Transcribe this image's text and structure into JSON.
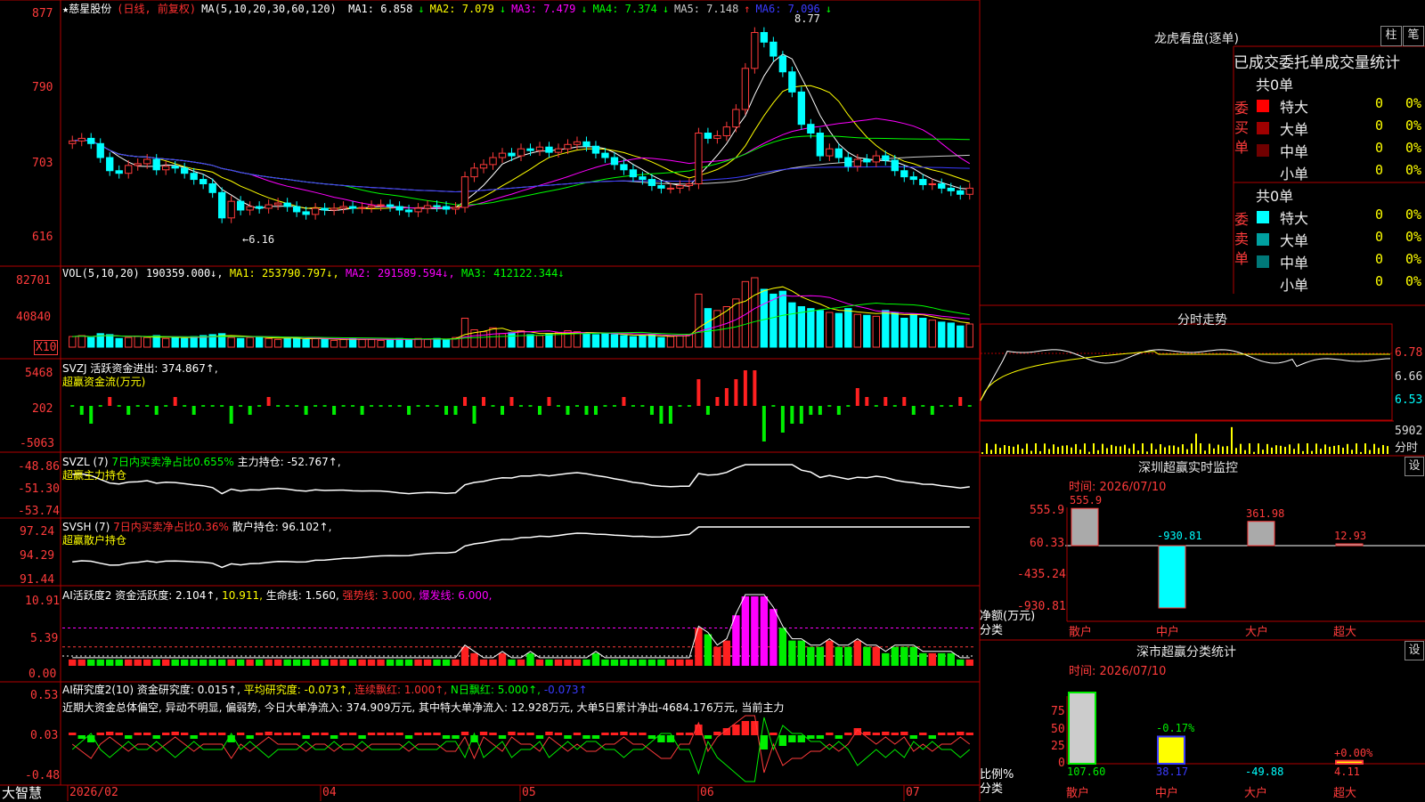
{
  "header": {
    "star": "★",
    "stock_name": "慈星股份",
    "period": "(日线, 前复权)",
    "ma_params": "MA(5,10,20,30,60,120)",
    "ma": [
      {
        "label": "MA1: 6.858",
        "arrow": "↓",
        "color": "#ffffff"
      },
      {
        "label": "MA2: 7.079",
        "arrow": "↓",
        "color": "#ffff00"
      },
      {
        "label": "MA3: 7.479",
        "arrow": "↓",
        "color": "#ff00ff"
      },
      {
        "label": "MA4: 7.374",
        "arrow": "↓",
        "color": "#00ff00"
      },
      {
        "label": "MA5: 7.148",
        "arrow": "↑",
        "color": "#cccccc"
      },
      {
        "label": "MA6: 7.096",
        "arrow": "↓",
        "color": "#3a3aff"
      }
    ]
  },
  "main_axis": {
    "top": "877",
    "t2": "790",
    "t3": "703",
    "t4": "616",
    "max_label": "8.77",
    "min_label": "←6.16"
  },
  "vol": {
    "header_title": "VOL(5,10,20)",
    "header_value": "190359.000↓,",
    "ma1": "MA1: 253790.797↓,",
    "ma2": "MA2: 291589.594↓,",
    "ma3": "MA3: 412122.344↓",
    "axis_top": "82701",
    "axis_mid": "40840",
    "axis_unit": "X10"
  },
  "svzj": {
    "title": "SVZJ  活跃资金进出: 374.867↑,",
    "sub": "超赢资金流(万元)",
    "axis_top": "5468",
    "axis_mid": "202",
    "axis_bot": "-5063"
  },
  "svzl": {
    "title_a": "SVZL (7)",
    "title_b": "7日内买卖净占比0.655%",
    "title_c": "主力持仓: -52.767↑,",
    "sub": "超赢主力持仓",
    "axis_top": "-48.86",
    "axis_mid": "-51.30",
    "axis_bot": "-53.74"
  },
  "svsh": {
    "title_a": "SVSH (7)",
    "title_b": "7日内买卖净占比0.36%",
    "title_c": "散户持仓: 96.102↑,",
    "sub": "超赢散户持仓",
    "axis_top": "97.24",
    "axis_mid": "94.29",
    "axis_bot": "91.44"
  },
  "ai_act": {
    "t1": "AI活跃度2 资金活跃度: 2.104↑,",
    "t2": "10.911,",
    "t3": "生命线: 1.560,",
    "t4": "强势线: 3.000,",
    "t5": "爆发线: 6.000,",
    "axis_top": "10.91",
    "axis_mid": "5.39",
    "axis_bot": "0.00"
  },
  "ai_res": {
    "t1": "AI研究度2(10) 资金研究度: 0.015↑,",
    "t2": "平均研究度: -0.073↑,",
    "t3": "连续飘红: 1.000↑,",
    "t4": "N日飘红: 5.000↑,",
    "t5": "-0.073↑",
    "summary": "近期大资金总体偏空, 异动不明显, 偏弱势, 今日大单净流入: 374.909万元, 其中特大单净流入: 12.928万元, 大单5日累计净出-4684.176万元, 当前主力",
    "axis_top": "0.53",
    "axis_mid": "0.03",
    "axis_bot": "-0.48"
  },
  "date_axis": {
    "brand": "大智慧",
    "labels": [
      "2026/02",
      "04",
      "05",
      "06",
      "07"
    ]
  },
  "right": {
    "lhb_title": "龙虎看盘(逐单)",
    "btn_zhu": "柱",
    "btn_bi": "笔",
    "stats_header": "已成交委托单成交量统计",
    "buy_label": "委买单",
    "sell_label": "委卖单",
    "buy_total": "共0单",
    "sell_total": "共0单",
    "buy_rows": [
      {
        "name": "特大",
        "count": "0",
        "pct": "0%",
        "color": "#ff0000"
      },
      {
        "name": "大单",
        "count": "0",
        "pct": "0%",
        "color": "#a00000"
      },
      {
        "name": "中单",
        "count": "0",
        "pct": "0%",
        "color": "#700000"
      },
      {
        "name": "小单",
        "count": "0",
        "pct": "0%",
        "color": ""
      }
    ],
    "sell_rows": [
      {
        "name": "特大",
        "count": "0",
        "pct": "0%",
        "color": "#00ffff"
      },
      {
        "name": "大单",
        "count": "0",
        "pct": "0%",
        "color": "#00a0a0"
      },
      {
        "name": "中单",
        "count": "0",
        "pct": "0%",
        "color": "#007878"
      },
      {
        "name": "小单",
        "count": "0",
        "pct": "0%",
        "color": ""
      }
    ],
    "fenshi_title": "分时走势",
    "fenshi_y": [
      "6.78",
      "6.66",
      "6.53"
    ],
    "fenshi_vol": "5902",
    "fenshi_unit": "分时",
    "sz_monitor_title": "深圳超赢实时监控",
    "sz_monitor_date": "时间: 2026/07/10",
    "sz_monitor_axis": [
      "555.9",
      "60.33",
      "-435.24",
      "-930.81"
    ],
    "sz_monitor_y_title": "净额(万元)",
    "sz_monitor_x_title": "分类",
    "sz_monitor_values": [
      {
        "name": "散户",
        "value": "555.9"
      },
      {
        "name": "中户",
        "value": "-930.81"
      },
      {
        "name": "大户",
        "value": "361.98"
      },
      {
        "name": "超大",
        "value": "12.93"
      }
    ],
    "sz_stat_title": "深市超赢分类统计",
    "sz_stat_date": "时间: 2026/07/10",
    "sz_stat_axis": [
      "75",
      "50",
      "25",
      "0"
    ],
    "sz_stat_y_title": "比例%",
    "sz_stat_x_title": "分类",
    "sz_stat_values": [
      {
        "name": "散户",
        "value": "107.60",
        "change": ""
      },
      {
        "name": "中户",
        "value": "38.17",
        "change": "-0.17%"
      },
      {
        "name": "大户",
        "value": "-49.88",
        "change": ""
      },
      {
        "name": "超大",
        "value": "4.11",
        "change": "+0.00%"
      }
    ],
    "set_btn": "设"
  },
  "chart_data": {
    "type": "candlestick",
    "price_range": [
      6.16,
      8.77
    ],
    "closes": [
      7.39,
      7.42,
      7.36,
      7.2,
      7.05,
      7.02,
      7.11,
      7.13,
      7.18,
      7.06,
      7.1,
      7.08,
      7.02,
      6.95,
      6.9,
      6.8,
      6.51,
      6.7,
      6.6,
      6.64,
      6.62,
      6.66,
      6.68,
      6.64,
      6.58,
      6.55,
      6.62,
      6.6,
      6.62,
      6.64,
      6.62,
      6.63,
      6.65,
      6.66,
      6.64,
      6.6,
      6.58,
      6.62,
      6.65,
      6.64,
      6.61,
      6.63,
      6.98,
      7.08,
      7.12,
      7.2,
      7.25,
      7.22,
      7.3,
      7.28,
      7.32,
      7.26,
      7.3,
      7.35,
      7.38,
      7.33,
      7.25,
      7.2,
      7.12,
      7.06,
      6.98,
      6.95,
      6.88,
      6.85,
      6.85,
      6.88,
      6.9,
      7.48,
      7.42,
      7.45,
      7.55,
      7.75,
      8.22,
      8.63,
      8.52,
      8.36,
      8.18,
      7.95,
      7.58,
      7.48,
      7.22,
      7.3,
      7.2,
      7.1,
      7.18,
      7.15,
      7.22,
      7.17,
      7.05,
      6.98,
      6.95,
      6.89,
      6.9,
      6.85,
      6.82,
      6.78,
      6.85
    ],
    "opens": [
      7.36,
      7.39,
      7.42,
      7.36,
      7.2,
      7.05,
      7.02,
      7.11,
      7.13,
      7.18,
      7.06,
      7.1,
      7.08,
      7.02,
      6.95,
      6.9,
      6.8,
      6.51,
      6.7,
      6.6,
      6.64,
      6.62,
      6.66,
      6.68,
      6.64,
      6.58,
      6.55,
      6.62,
      6.6,
      6.62,
      6.64,
      6.62,
      6.63,
      6.65,
      6.66,
      6.64,
      6.6,
      6.58,
      6.62,
      6.65,
      6.64,
      6.61,
      6.63,
      6.98,
      7.08,
      7.12,
      7.2,
      7.25,
      7.22,
      7.3,
      7.28,
      7.32,
      7.26,
      7.3,
      7.35,
      7.38,
      7.33,
      7.25,
      7.2,
      7.12,
      7.06,
      6.98,
      6.95,
      6.88,
      6.85,
      6.85,
      6.88,
      6.9,
      7.48,
      7.42,
      7.45,
      7.55,
      7.75,
      8.22,
      8.63,
      8.52,
      8.36,
      8.18,
      7.95,
      7.58,
      7.48,
      7.22,
      7.3,
      7.2,
      7.1,
      7.18,
      7.15,
      7.22,
      7.17,
      7.05,
      6.98,
      6.95,
      6.89,
      6.9,
      6.85,
      6.82,
      6.78
    ],
    "volumes": [
      11,
      12,
      10,
      14,
      13,
      9,
      10,
      11,
      10,
      12,
      9,
      10,
      9,
      11,
      12,
      13,
      14,
      10,
      9,
      10,
      11,
      9,
      8,
      9,
      10,
      8,
      9,
      8,
      7,
      8,
      9,
      8,
      8,
      7,
      8,
      9,
      8,
      9,
      8,
      9,
      8,
      10,
      30,
      18,
      16,
      20,
      14,
      15,
      17,
      13,
      12,
      14,
      15,
      17,
      16,
      14,
      13,
      14,
      13,
      12,
      11,
      12,
      13,
      10,
      11,
      12,
      13,
      55,
      40,
      38,
      42,
      50,
      68,
      72,
      60,
      55,
      58,
      46,
      42,
      40,
      38,
      36,
      35,
      40,
      34,
      33,
      32,
      38,
      36,
      30,
      34,
      30,
      28,
      26,
      25,
      22,
      24
    ],
    "svzj": [
      0,
      -1,
      -2,
      0,
      1,
      0,
      -1,
      0,
      0,
      -1,
      0,
      1,
      0,
      -1,
      0,
      0,
      0,
      -2,
      0,
      -1,
      0,
      1,
      0,
      0,
      0,
      -1,
      0,
      0,
      -1,
      0,
      0,
      -1,
      0,
      0,
      0,
      0,
      -1,
      0,
      0,
      0,
      -1,
      -1,
      1,
      -2,
      1,
      0,
      -1,
      1,
      0,
      0,
      -1,
      1,
      0,
      -1,
      0,
      -1,
      -1,
      0,
      0,
      1,
      0,
      0,
      -1,
      -2,
      -2,
      0,
      0,
      3,
      -1,
      1,
      2,
      3,
      4,
      4,
      -4,
      0,
      -3,
      -2,
      -2,
      -1,
      -1,
      0,
      -1,
      0,
      2,
      1,
      0,
      1,
      0,
      1,
      -1,
      0,
      -1,
      0,
      0,
      1,
      0
    ],
    "activity": [
      1,
      1,
      1,
      1,
      1,
      1,
      1,
      1,
      1,
      1,
      1,
      1,
      1,
      1,
      1,
      1,
      1,
      1,
      1,
      1,
      1,
      1,
      1,
      1,
      1,
      1,
      1,
      1,
      1,
      1,
      1,
      1,
      1,
      1,
      1,
      1,
      1,
      1,
      1,
      1,
      1,
      1,
      3,
      2,
      1,
      1,
      2,
      1,
      1,
      2,
      1,
      1,
      1,
      1,
      1,
      1,
      2,
      1,
      1,
      1,
      1,
      1,
      1,
      1,
      1,
      1,
      1,
      6,
      5,
      3,
      4,
      8,
      11,
      11,
      11,
      9,
      6,
      4,
      4,
      3,
      3,
      4,
      3,
      3,
      4,
      3,
      3,
      2,
      3,
      3,
      3,
      2,
      2,
      2,
      2,
      1,
      1
    ]
  }
}
